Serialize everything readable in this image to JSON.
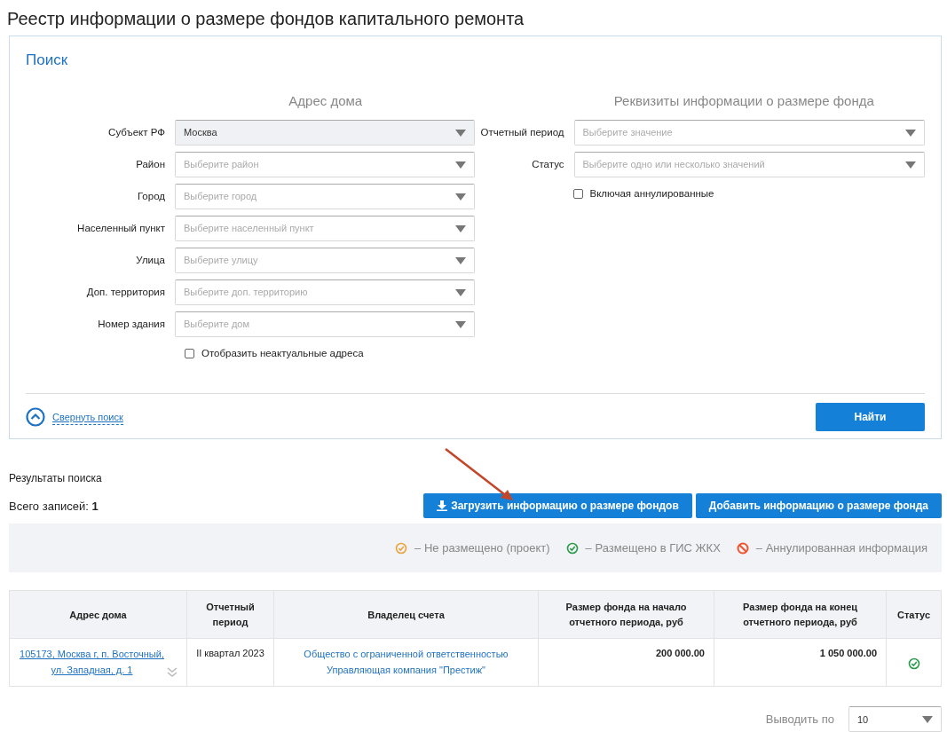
{
  "page_title": "Реестр информации о размере фондов капитального ремонта",
  "search": {
    "title": "Поиск",
    "address": {
      "heading": "Адрес дома",
      "fields": [
        {
          "label": "Субъект РФ",
          "value": "Москва",
          "disabled": true
        },
        {
          "label": "Район",
          "placeholder": "Выберите район",
          "disabled": false
        },
        {
          "label": "Город",
          "placeholder": "Выберите город",
          "disabled": false
        },
        {
          "label": "Населенный пункт",
          "placeholder": "Выберите населенный пункт",
          "disabled": false
        },
        {
          "label": "Улица",
          "placeholder": "Выберите улицу",
          "disabled": false
        },
        {
          "label": "Доп. территория",
          "placeholder": "Выберите доп. территорию",
          "disabled": false
        },
        {
          "label": "Номер здания",
          "placeholder": "Выберите дом",
          "disabled": false
        }
      ],
      "checkbox": {
        "label": "Отобразить неактуальные адреса",
        "checked": false
      }
    },
    "details": {
      "heading": "Реквизиты информации о размере фонда",
      "fields": [
        {
          "label": "Отчетный период",
          "placeholder": "Выберите значение",
          "disabled": false
        },
        {
          "label": "Статус",
          "placeholder": "Выберите одно или несколько значений",
          "disabled": false
        }
      ],
      "checkbox": {
        "label": "Включая аннулированные",
        "checked": false
      }
    },
    "collapse_link": "Свернуть поиск",
    "find_button": "Найти"
  },
  "results": {
    "title": "Результаты поиска",
    "total_label": "Всего записей:",
    "total": "1",
    "buttons": [
      {
        "label": "Загрузить информацию о размере фондов",
        "kind": "upload"
      },
      {
        "label": "Добавить информацию о размере фонда",
        "kind": "plain"
      }
    ],
    "legend": [
      {
        "kind": "draft",
        "label": "–  Не размещено (проект)",
        "color": "#e8a33d"
      },
      {
        "kind": "placed",
        "label": "–  Размещено в ГИС ЖКХ",
        "color": "#2a9a4a"
      },
      {
        "kind": "annulled",
        "label": "–  Аннулированная информация",
        "color": "#f0532d"
      }
    ]
  },
  "table": {
    "columns": [
      "Адрес дома",
      "Отчетный период",
      "Владелец счета",
      "Размер фонда на начало отчетного периода, руб",
      "Размер фонда на конец отчетного периода, руб",
      "Статус"
    ],
    "rows": [
      {
        "address": "105173, Москва г, п. Восточный, ул. Западная, д. 1",
        "period": "II квартал 2023",
        "owner": "Общество с ограниченной ответственностью Управляющая компания \"Престиж\"",
        "start": "200 000.00",
        "end": "1 050 000.00",
        "kind": "placed",
        "color": "#2a9a4a"
      }
    ]
  },
  "pager": {
    "label": "Выводить по",
    "value": "10"
  }
}
